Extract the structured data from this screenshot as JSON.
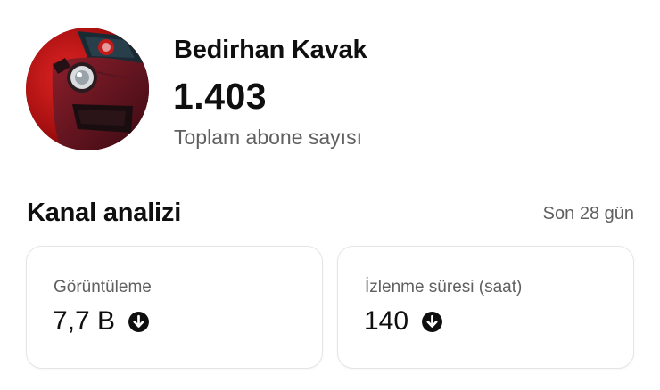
{
  "profile": {
    "channel_name": "Bedirhan Kavak",
    "subscriber_count": "1.403",
    "subscriber_label": "Toplam abone sayısı"
  },
  "analytics": {
    "title": "Kanal analizi",
    "period": "Son 28 gün",
    "cards": [
      {
        "label": "Görüntüleme",
        "value": "7,7 B",
        "trend_icon": "arrow-down-circle-icon"
      },
      {
        "label": "İzlenme süresi (saat)",
        "value": "140",
        "trend_icon": "arrow-down-circle-icon"
      }
    ]
  },
  "colors": {
    "text_primary": "#0f0f0f",
    "text_secondary": "#606060",
    "card_border": "#e5e5e5",
    "avatar_red": "#b81818"
  }
}
